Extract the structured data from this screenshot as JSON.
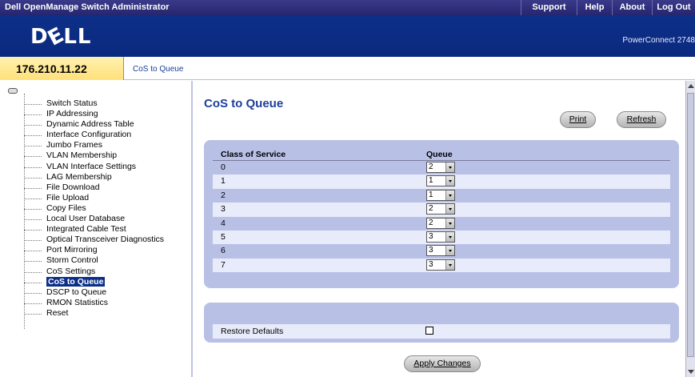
{
  "topbar": {
    "title": "Dell OpenManage Switch Administrator",
    "links": [
      "Support",
      "Help",
      "About",
      "Log Out"
    ]
  },
  "logo": {
    "text_d": "D",
    "text_e": "E",
    "text_ll": "LL"
  },
  "model": "PowerConnect 2748",
  "device_ip": "176.210.11.22",
  "breadcrumb": "CoS to Queue",
  "nav": {
    "items": [
      "Switch Status",
      "IP Addressing",
      "Dynamic Address Table",
      "Interface Configuration",
      "Jumbo Frames",
      "VLAN Membership",
      "VLAN Interface Settings",
      "LAG Membership",
      "File Download",
      "File Upload",
      "Copy Files",
      "Local User Database",
      "Integrated Cable Test",
      "Optical Transceiver Diagnostics",
      "Port Mirroring",
      "Storm Control",
      "CoS Settings",
      "CoS to Queue",
      "DSCP to Queue",
      "RMON Statistics",
      "Reset"
    ],
    "active_index": 17
  },
  "page": {
    "title": "CoS to Queue",
    "print_label": "Print",
    "refresh_label": "Refresh",
    "table": {
      "col_cos": "Class of Service",
      "col_queue": "Queue",
      "rows": [
        {
          "cos": "0",
          "queue": "2"
        },
        {
          "cos": "1",
          "queue": "1"
        },
        {
          "cos": "2",
          "queue": "1"
        },
        {
          "cos": "3",
          "queue": "2"
        },
        {
          "cos": "4",
          "queue": "2"
        },
        {
          "cos": "5",
          "queue": "3"
        },
        {
          "cos": "6",
          "queue": "3"
        },
        {
          "cos": "7",
          "queue": "3"
        }
      ]
    },
    "restore_label": "Restore Defaults",
    "restore_checked": false,
    "apply_label": "Apply Changes"
  },
  "colors": {
    "header_blue": "#0d2f88",
    "panel": "#b9c0e6",
    "title": "#1c3f9c",
    "ip_box": "#ffe07a"
  }
}
